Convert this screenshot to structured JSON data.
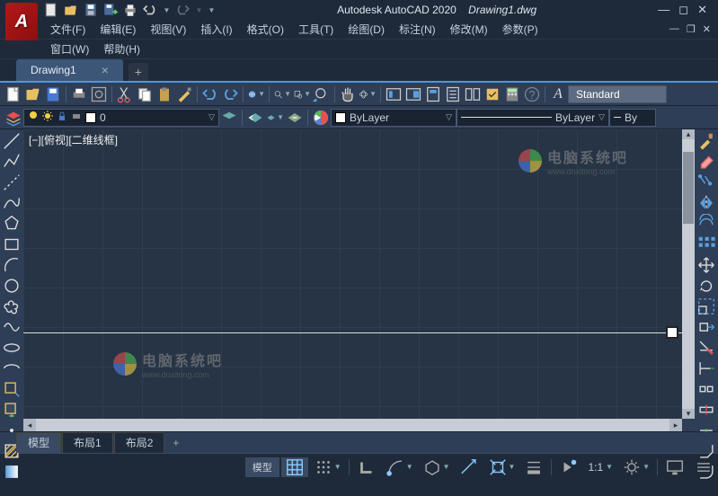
{
  "title": {
    "app": "Autodesk AutoCAD 2020",
    "file": "Drawing1.dwg"
  },
  "menu": {
    "row1": [
      "文件(F)",
      "编辑(E)",
      "视图(V)",
      "插入(I)",
      "格式(O)",
      "工具(T)",
      "绘图(D)",
      "标注(N)",
      "修改(M)",
      "参数(P)"
    ],
    "row2": [
      "窗口(W)",
      "帮助(H)"
    ]
  },
  "tabs": {
    "active": "Drawing1"
  },
  "text_style": "Standard",
  "layer": {
    "current": "0",
    "bylayer1": "ByLayer",
    "bylayer2": "ByLayer",
    "bylayer3": "By"
  },
  "viewport_label": "[−][俯视][二维线框]",
  "watermark": {
    "text_big": "电脑系统吧",
    "text_small": "www.dnxitong.com"
  },
  "layout_tabs": [
    "模型",
    "布局1",
    "布局2"
  ],
  "status": {
    "model": "模型",
    "scale": "1:1"
  }
}
